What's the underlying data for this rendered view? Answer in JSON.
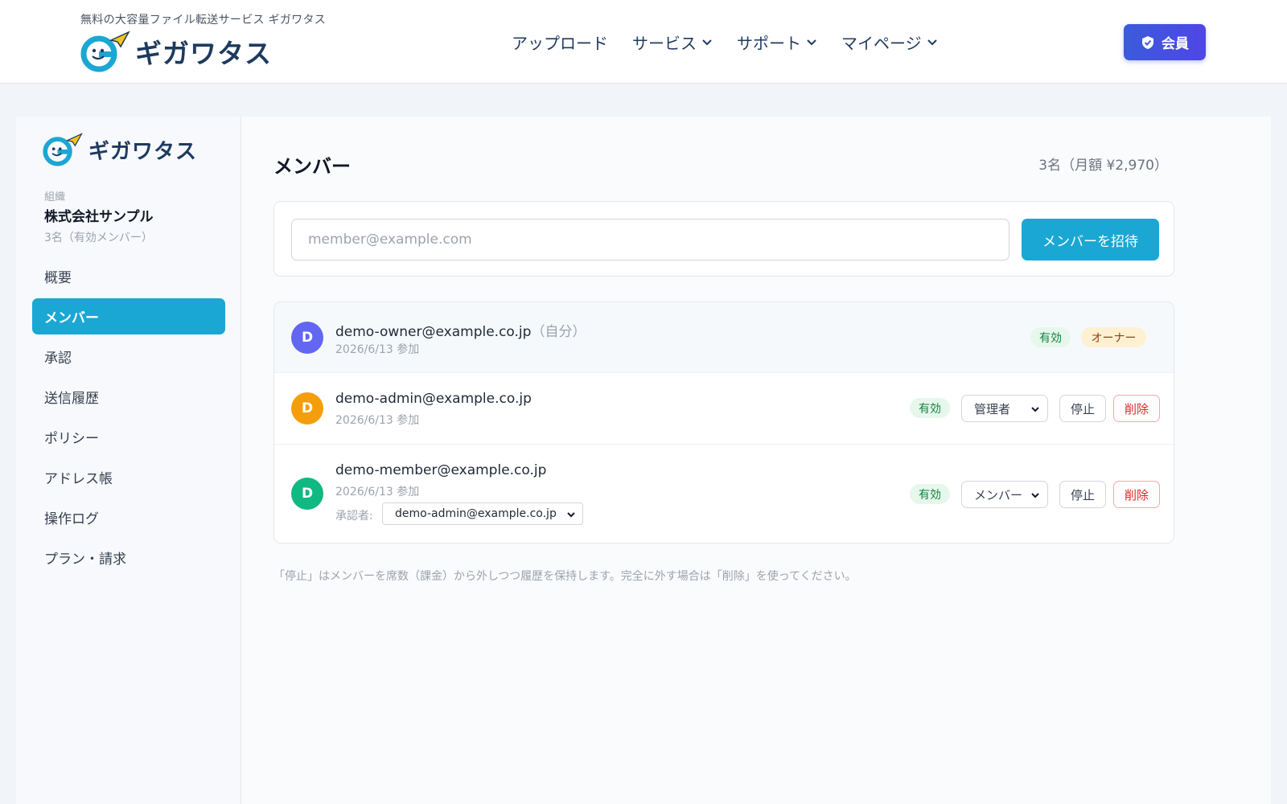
{
  "header": {
    "tagline": "無料の大容量ファイル転送サービス ギガワタス",
    "brand_name": "ギガワタス",
    "nav": [
      {
        "label": "アップロード",
        "has_dropdown": false
      },
      {
        "label": "サービス",
        "has_dropdown": true
      },
      {
        "label": "サポート",
        "has_dropdown": true
      },
      {
        "label": "マイページ",
        "has_dropdown": true
      }
    ],
    "member_button": {
      "label": "会員",
      "icon": "shield-check-icon"
    }
  },
  "sidebar": {
    "brand_name": "ギガワタス",
    "org_label": "組織",
    "org_name": "株式会社サンプル",
    "org_count": "3名（有効メンバー）",
    "items": [
      {
        "label": "概要",
        "active": false
      },
      {
        "label": "メンバー",
        "active": true
      },
      {
        "label": "承認",
        "active": false
      },
      {
        "label": "送信履歴",
        "active": false
      },
      {
        "label": "ポリシー",
        "active": false
      },
      {
        "label": "アドレス帳",
        "active": false
      },
      {
        "label": "操作ログ",
        "active": false
      },
      {
        "label": "プラン・請求",
        "active": false
      }
    ]
  },
  "main": {
    "title": "メンバー",
    "seat_summary": "3名（月額 ¥2,970）",
    "invite": {
      "placeholder": "member@example.com",
      "value": "",
      "button_label": "メンバーを招待"
    },
    "members": [
      {
        "initial": "D",
        "avatar_color": "#6366f1",
        "email": "demo-owner@example.co.jp",
        "self_tag": "（自分）",
        "joined": "2026/6/13 参加",
        "status": "有効",
        "role_badge": "オーナー"
      },
      {
        "initial": "D",
        "avatar_color": "#f59e0b",
        "email": "demo-admin@example.co.jp",
        "joined": "2026/6/13 参加",
        "status": "有効",
        "role": "管理者",
        "stop_label": "停止",
        "delete_label": "削除"
      },
      {
        "initial": "D",
        "avatar_color": "#10b981",
        "email": "demo-member@example.co.jp",
        "joined": "2026/6/13 参加",
        "approver_label": "承認者:",
        "approver": "demo-admin@example.co.jp",
        "status": "有効",
        "role": "メンバー",
        "stop_label": "停止",
        "delete_label": "削除"
      }
    ],
    "footnote": "「停止」はメンバーを席数（課金）から外しつつ履歴を保持します。完全に外す場合は「削除」を使ってください。"
  },
  "colors": {
    "accent": "#1aa7d3",
    "member_button": "#3b5bdb",
    "brand_text": "#1e3a5f"
  }
}
